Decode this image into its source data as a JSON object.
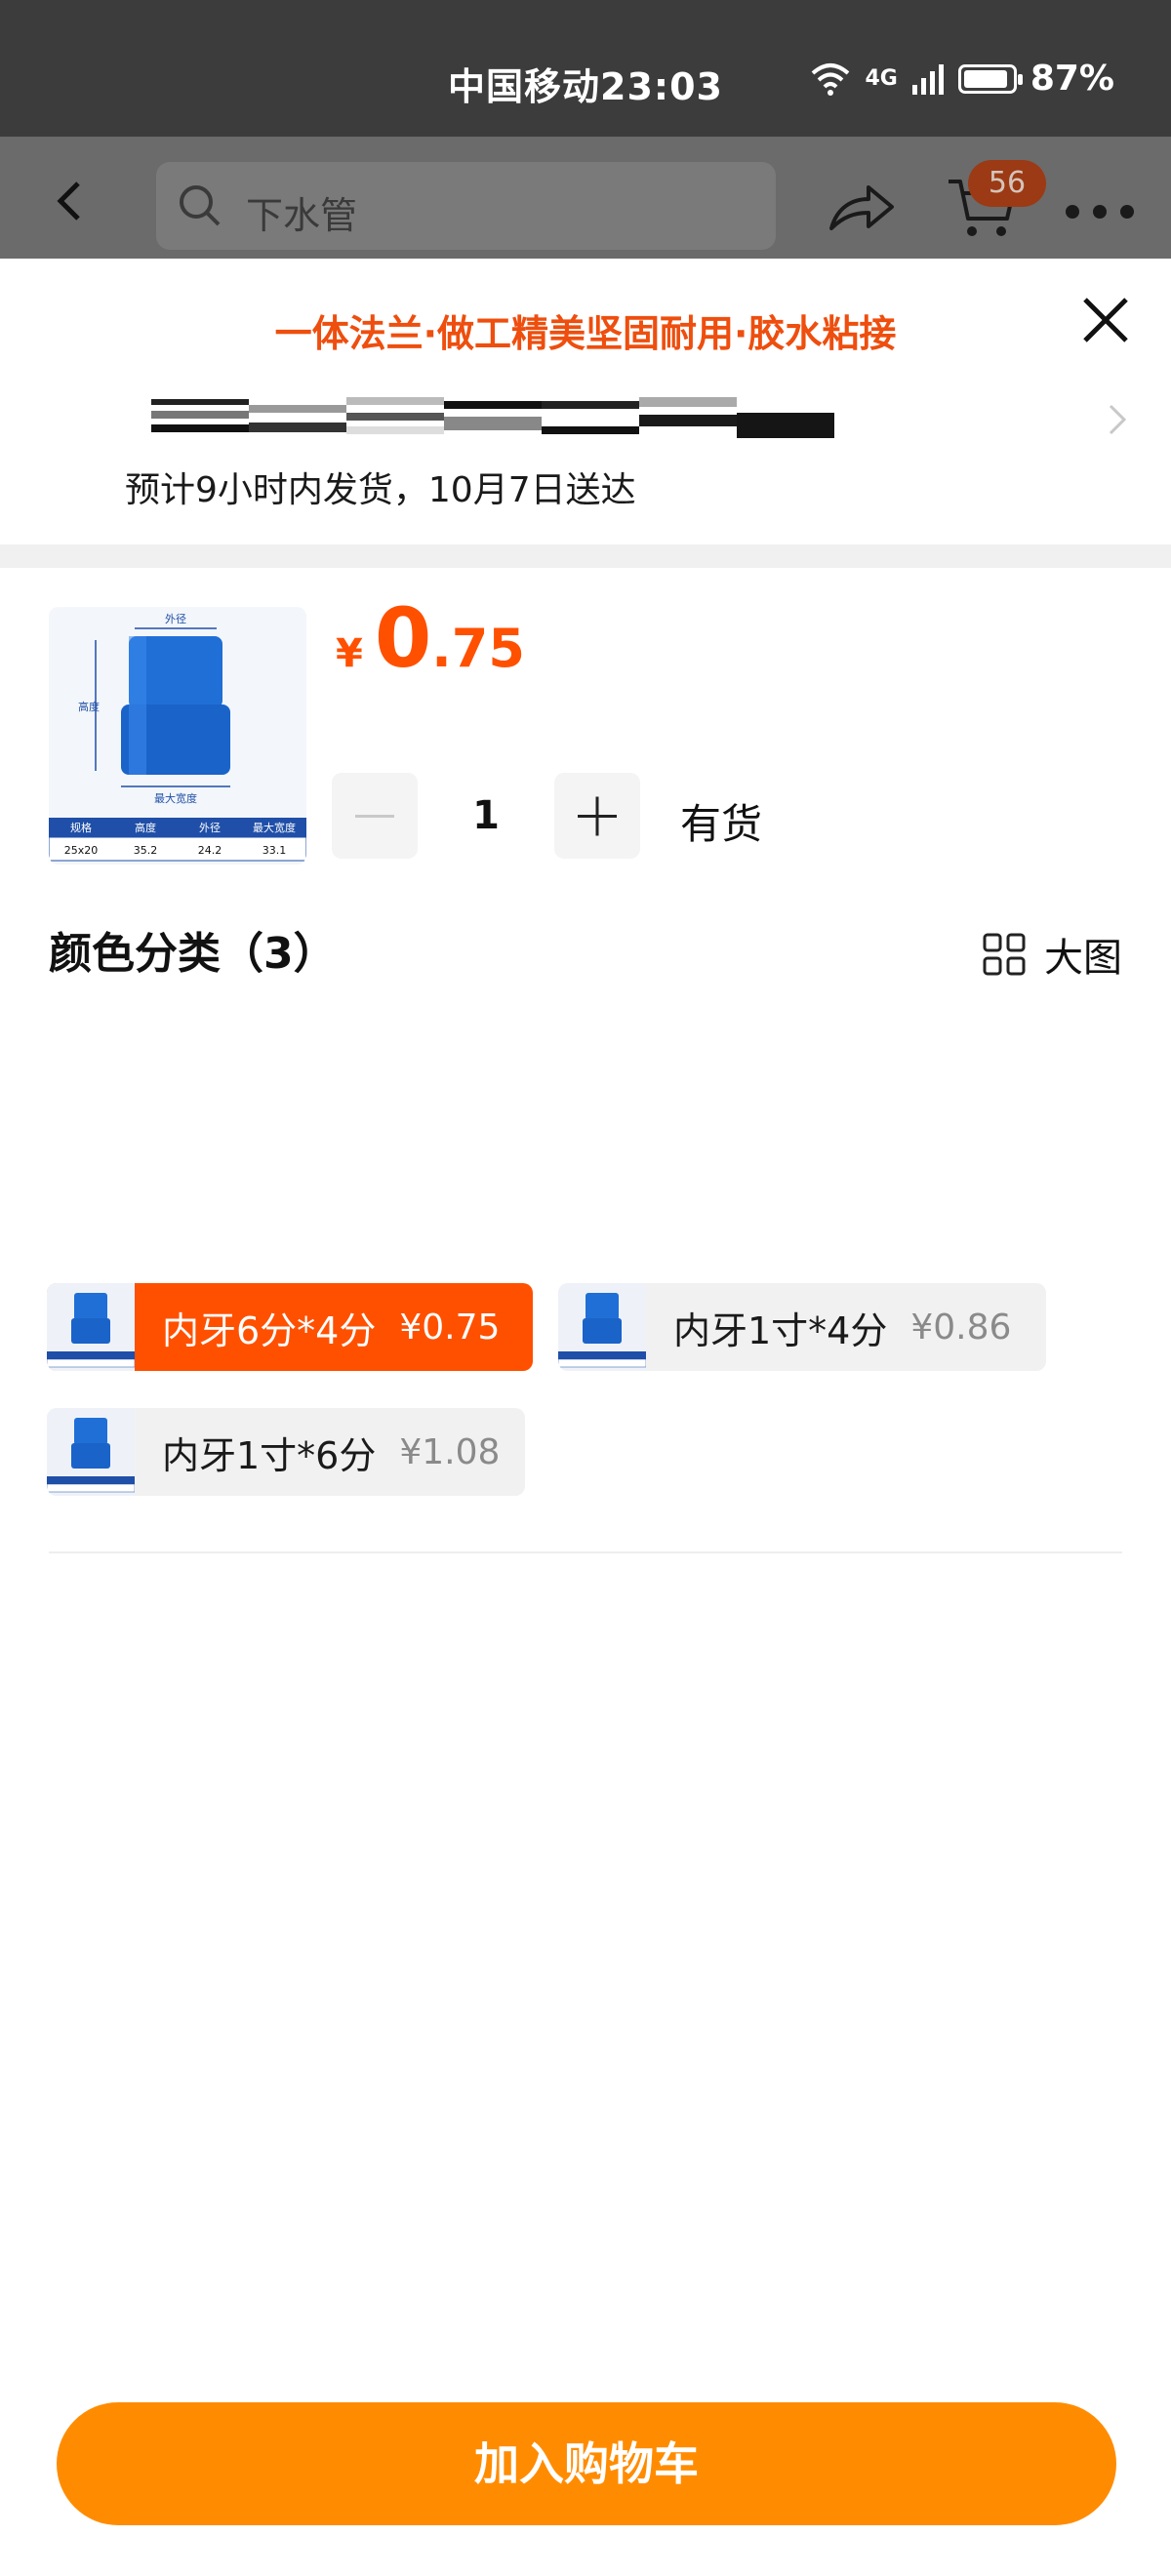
{
  "status_bar": {
    "carrier_time": "中国移动23:03",
    "network": "4G",
    "battery": "87%"
  },
  "top_nav": {
    "search_text": "下水管",
    "cart_badge": "56"
  },
  "sheet": {
    "promo": "一体法兰·做工精美坚固耐用·胶水粘接",
    "delivery": "预计9小时内发货，10月7日送达",
    "product": {
      "currency": "¥",
      "price_int": "0",
      "price_dec": ".75",
      "thumb_labels": {
        "outer": "外径",
        "height": "高度",
        "max_width": "最大宽度",
        "table_headers": [
          "规格",
          "高度",
          "外径",
          "最大宽度"
        ],
        "table_values": [
          "25x20",
          "35.2",
          "24.2",
          "33.1"
        ]
      }
    },
    "quantity": "1",
    "stock": "有货",
    "sku_title": "颜色分类（3）",
    "big_pic_label": "大图",
    "options": [
      {
        "name": "内牙6分*4分",
        "price": "¥0.75",
        "selected": true
      },
      {
        "name": "内牙1寸*4分",
        "price": "¥0.86",
        "selected": false
      },
      {
        "name": "内牙1寸*6分",
        "price": "¥1.08",
        "selected": false
      }
    ],
    "add_to_cart": "加入购物车"
  },
  "colors": {
    "accent": "#ff5000",
    "promo": "#ee4e0e",
    "button": "#ff8c00",
    "product_blue": "#1f6fd6"
  }
}
